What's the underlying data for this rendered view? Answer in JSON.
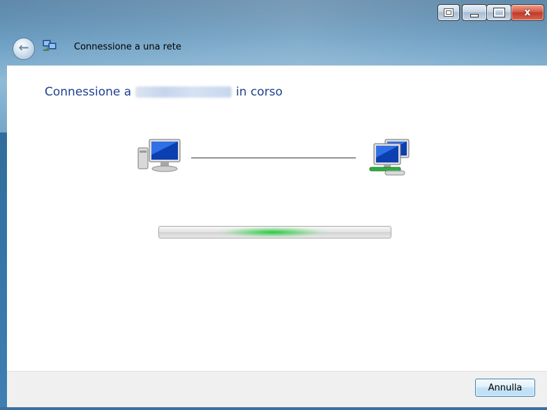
{
  "window": {
    "title": "Connessione a una rete",
    "icons": {
      "back": "back-arrow-icon",
      "app": "network-connection-icon",
      "help": "help-icon",
      "minimize": "minimize-icon",
      "maximize": "maximize-icon",
      "close": "close-icon"
    },
    "close_glyph": "x"
  },
  "main": {
    "heading_prefix": "Connessione a",
    "network_name_redacted": "",
    "heading_suffix": "in corso",
    "progress": {
      "state": "indeterminate",
      "indicator_position_fraction": 0.49
    }
  },
  "footer": {
    "cancel_label": "Annulla"
  },
  "colors": {
    "heading": "#1f3f8f",
    "progress_glow": "#22c838",
    "footer_bg": "#f0f0f0",
    "cancel_border": "#3c7fb1"
  }
}
